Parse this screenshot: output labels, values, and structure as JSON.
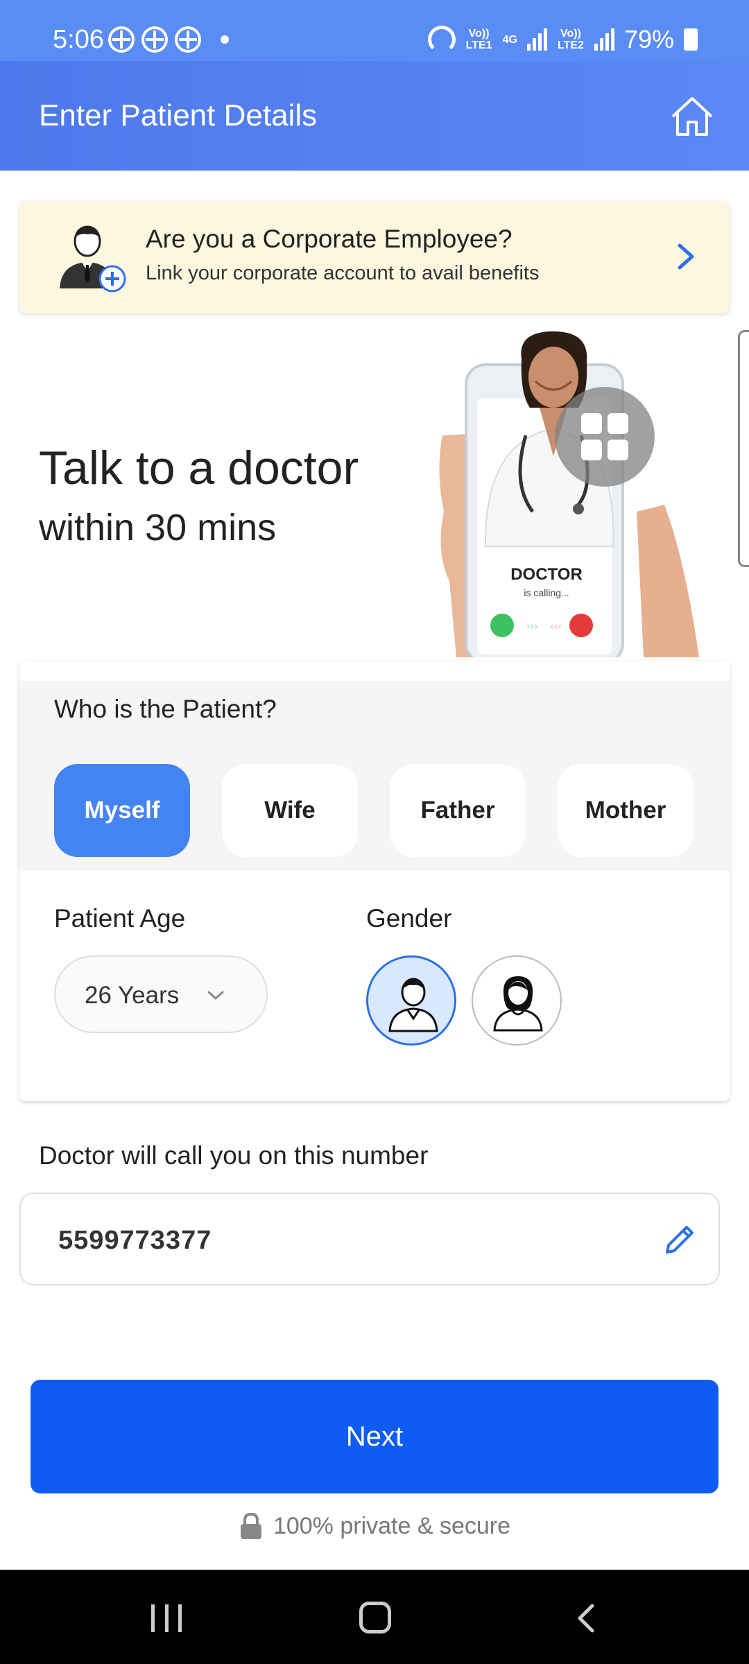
{
  "status_bar": {
    "time": "5:06",
    "network_1": "Vo)) LTE1",
    "network_2": "4G",
    "network_3": "Vo)) LTE2",
    "battery": "79%"
  },
  "header": {
    "title": "Enter Patient Details",
    "home_icon": "home-icon"
  },
  "corporate_banner": {
    "title": "Are you a Corporate Employee?",
    "subtitle": "Link your corporate account to avail benefits"
  },
  "hero": {
    "title": "Talk to a doctor",
    "subtitle": "within 30 mins",
    "illustration_caption": "DOCTOR",
    "illustration_sub": "is calling..."
  },
  "patient": {
    "question": "Who is the Patient?",
    "options": [
      "Myself",
      "Wife",
      "Father",
      "Mother"
    ],
    "selected": "Myself",
    "age_label": "Patient Age",
    "age_value": "26 Years",
    "gender_label": "Gender",
    "gender_selected": "male"
  },
  "phone": {
    "label": "Doctor will call you on this number",
    "value": "5599773377"
  },
  "actions": {
    "next_label": "Next",
    "secure_text": "100% private & secure"
  },
  "colors": {
    "header": "#4d79ec",
    "primary_button": "#0f5cf5",
    "chip_active": "#4384f0",
    "banner_bg": "#fdf7e0"
  }
}
